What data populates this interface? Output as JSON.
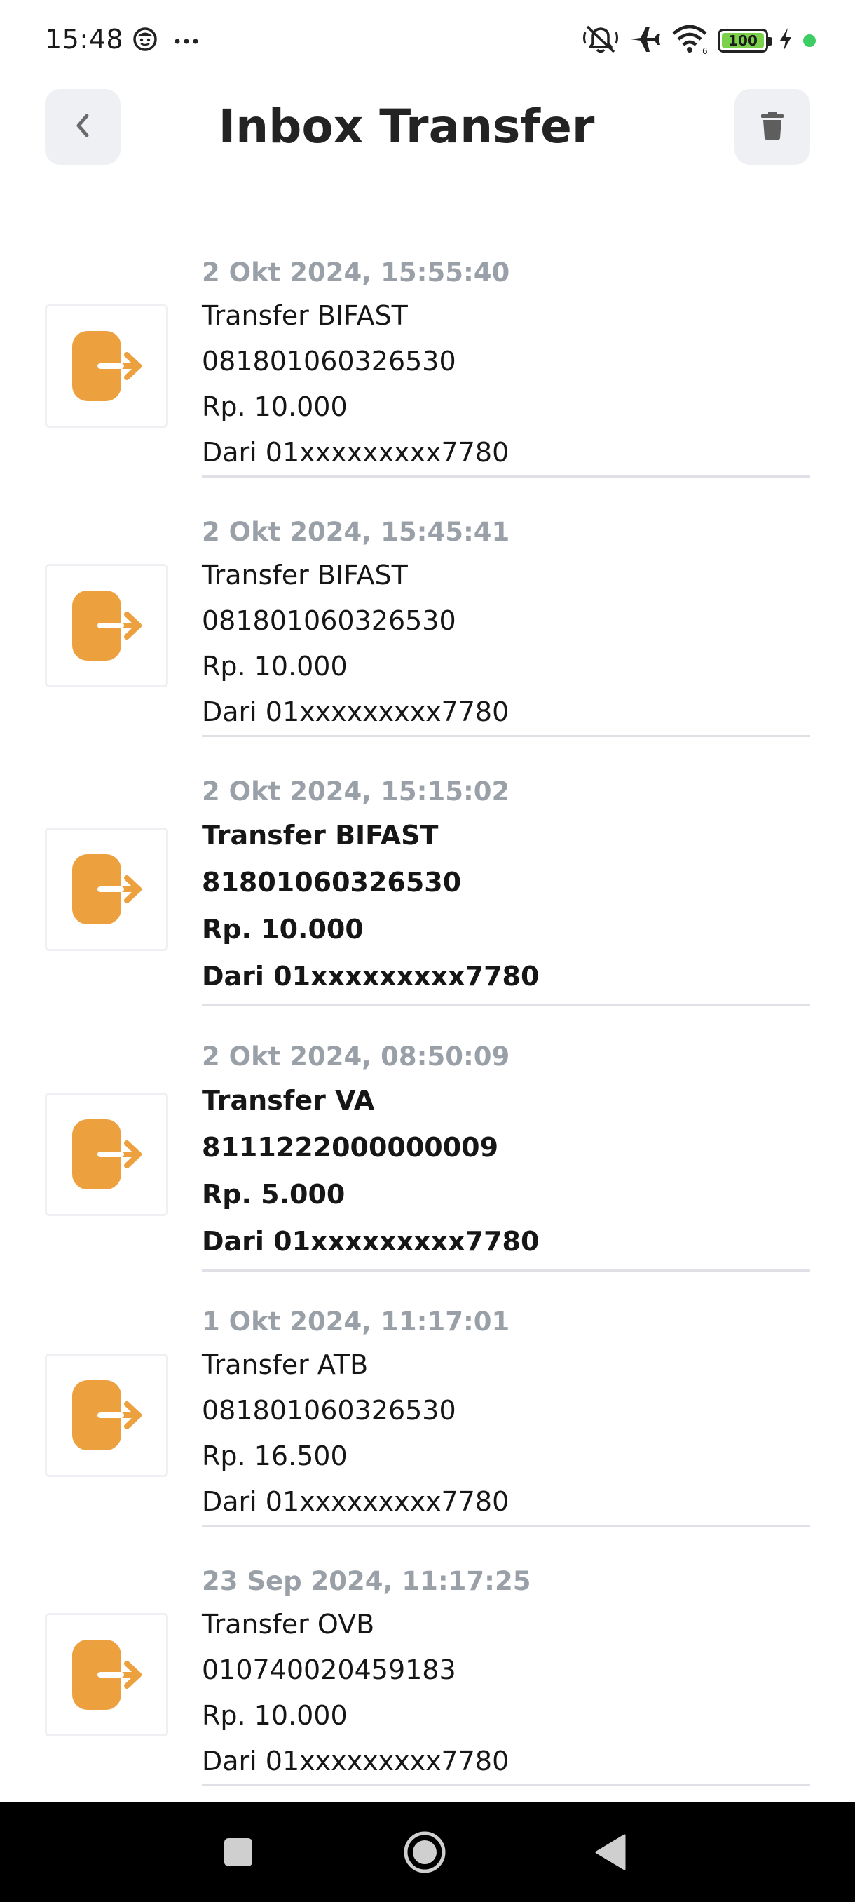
{
  "status_bar": {
    "time": "15:48",
    "battery_level": "100",
    "icons": [
      "face-icon",
      "more-dots-icon",
      "mute-bell-icon",
      "airplane-icon",
      "wifi-icon",
      "battery-icon",
      "charging-bolt-icon"
    ]
  },
  "header": {
    "title": "Inbox Transfer",
    "back_icon": "chevron-left-icon",
    "delete_icon": "trash-icon"
  },
  "colors": {
    "accent_orange": "#ECA03E",
    "date_gray": "#9AA0A8",
    "divider": "#DFE1E6",
    "icon_button_bg": "#EEF0F4"
  },
  "transfers": [
    {
      "date": "2 Okt 2024, 15:55:40",
      "type": "Transfer BIFAST",
      "account": "081801060326530",
      "amount": "Rp. 10.000",
      "from": "Dari 01xxxxxxxxx7780",
      "unread": false
    },
    {
      "date": "2 Okt 2024, 15:45:41",
      "type": "Transfer BIFAST",
      "account": "081801060326530",
      "amount": "Rp. 10.000",
      "from": "Dari 01xxxxxxxxx7780",
      "unread": false
    },
    {
      "date": "2 Okt 2024, 15:15:02",
      "type": "Transfer BIFAST",
      "account": "81801060326530",
      "amount": "Rp. 10.000",
      "from": "Dari 01xxxxxxxxx7780",
      "unread": true
    },
    {
      "date": "2 Okt 2024, 08:50:09",
      "type": "Transfer VA",
      "account": "8111222000000009",
      "amount": "Rp. 5.000",
      "from": "Dari 01xxxxxxxxx7780",
      "unread": true
    },
    {
      "date": "1 Okt 2024, 11:17:01",
      "type": "Transfer ATB",
      "account": "081801060326530",
      "amount": "Rp. 16.500",
      "from": "Dari 01xxxxxxxxx7780",
      "unread": false
    },
    {
      "date": "23 Sep 2024, 11:17:25",
      "type": "Transfer OVB",
      "account": "010740020459183",
      "amount": "Rp. 10.000",
      "from": "Dari 01xxxxxxxxx7780",
      "unread": false
    }
  ],
  "nav_bar": {
    "icons": [
      "recents-square-icon",
      "home-circle-icon",
      "back-triangle-icon"
    ]
  }
}
